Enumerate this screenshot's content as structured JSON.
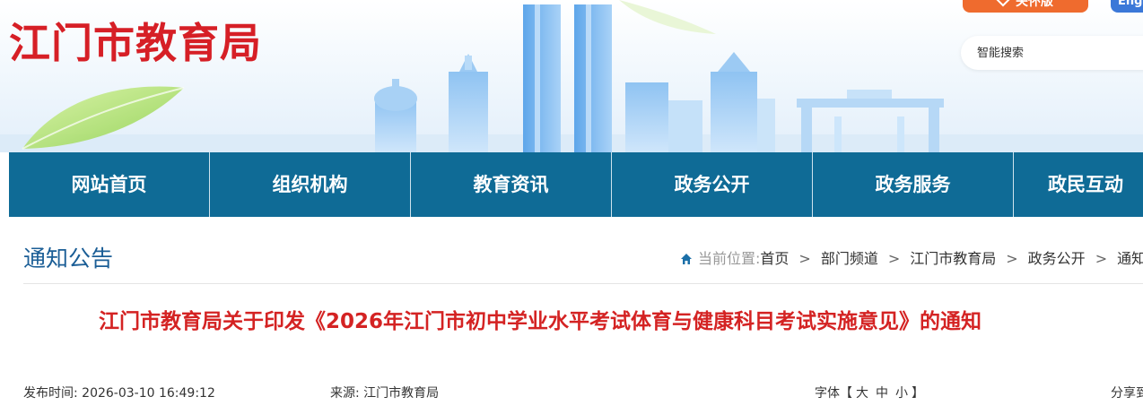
{
  "header": {
    "site_title": "江门市教育局",
    "top_button_orange": "关怀版",
    "top_button_blue": "English",
    "search": {
      "placeholder": "智能搜索"
    }
  },
  "nav": {
    "items": [
      {
        "label": "网站首页"
      },
      {
        "label": "组织机构"
      },
      {
        "label": "教育资讯"
      },
      {
        "label": "政务公开"
      },
      {
        "label": "政务服务"
      },
      {
        "label": "政民互动"
      }
    ]
  },
  "section": {
    "title": "通知公告"
  },
  "breadcrumb": {
    "prefix": "当前位置:",
    "items": [
      "首页",
      "部门频道",
      "江门市教育局",
      "政务公开",
      "通知公告"
    ],
    "separator": ">"
  },
  "article": {
    "title": "江门市教育局关于印发《2026年江门市初中学业水平考试体育与健康科目考试实施意见》的通知",
    "publish_label": "发布时间:",
    "publish_time": "2026-03-10 16:49:12",
    "source_label": "来源:",
    "source": "江门市教育局",
    "font_label": "字体",
    "font_bracket_open": "【",
    "font_sizes": [
      "大",
      "中",
      "小"
    ],
    "font_bracket_close": "】",
    "share_label": "分享到:"
  },
  "colors": {
    "brand_red": "#d61f26",
    "nav_blue": "#0f6b96",
    "section_title_blue": "#1b5e96",
    "article_title_red": "#d42323",
    "orange_button": "#ef6b2e",
    "blue_button": "#3b78d8"
  },
  "icons": {
    "breadcrumb": "home-icon",
    "top_orange": "diamond-icon"
  }
}
